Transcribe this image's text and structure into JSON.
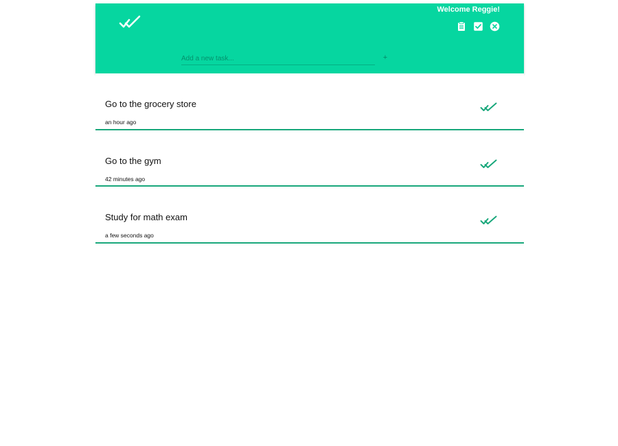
{
  "header": {
    "logo_icon": "double-check-icon",
    "welcome_text": "Welcome Reggie!",
    "actions": [
      {
        "name": "clipboard-icon"
      },
      {
        "name": "checkbox-icon"
      },
      {
        "name": "close-circle-icon"
      }
    ],
    "new_task": {
      "placeholder": "Add a new task...",
      "value": "",
      "add_label": "+"
    },
    "colors": {
      "accent": "#06d6a0",
      "divider": "#18a77b",
      "white": "#ffffff"
    }
  },
  "tasks": [
    {
      "title": "Go to the grocery store",
      "time": "an hour ago",
      "icon": "double-check-icon"
    },
    {
      "title": "Go to the gym",
      "time": "42 minutes ago",
      "icon": "double-check-icon"
    },
    {
      "title": "Study for math exam",
      "time": "a few seconds ago",
      "icon": "double-check-icon"
    }
  ]
}
